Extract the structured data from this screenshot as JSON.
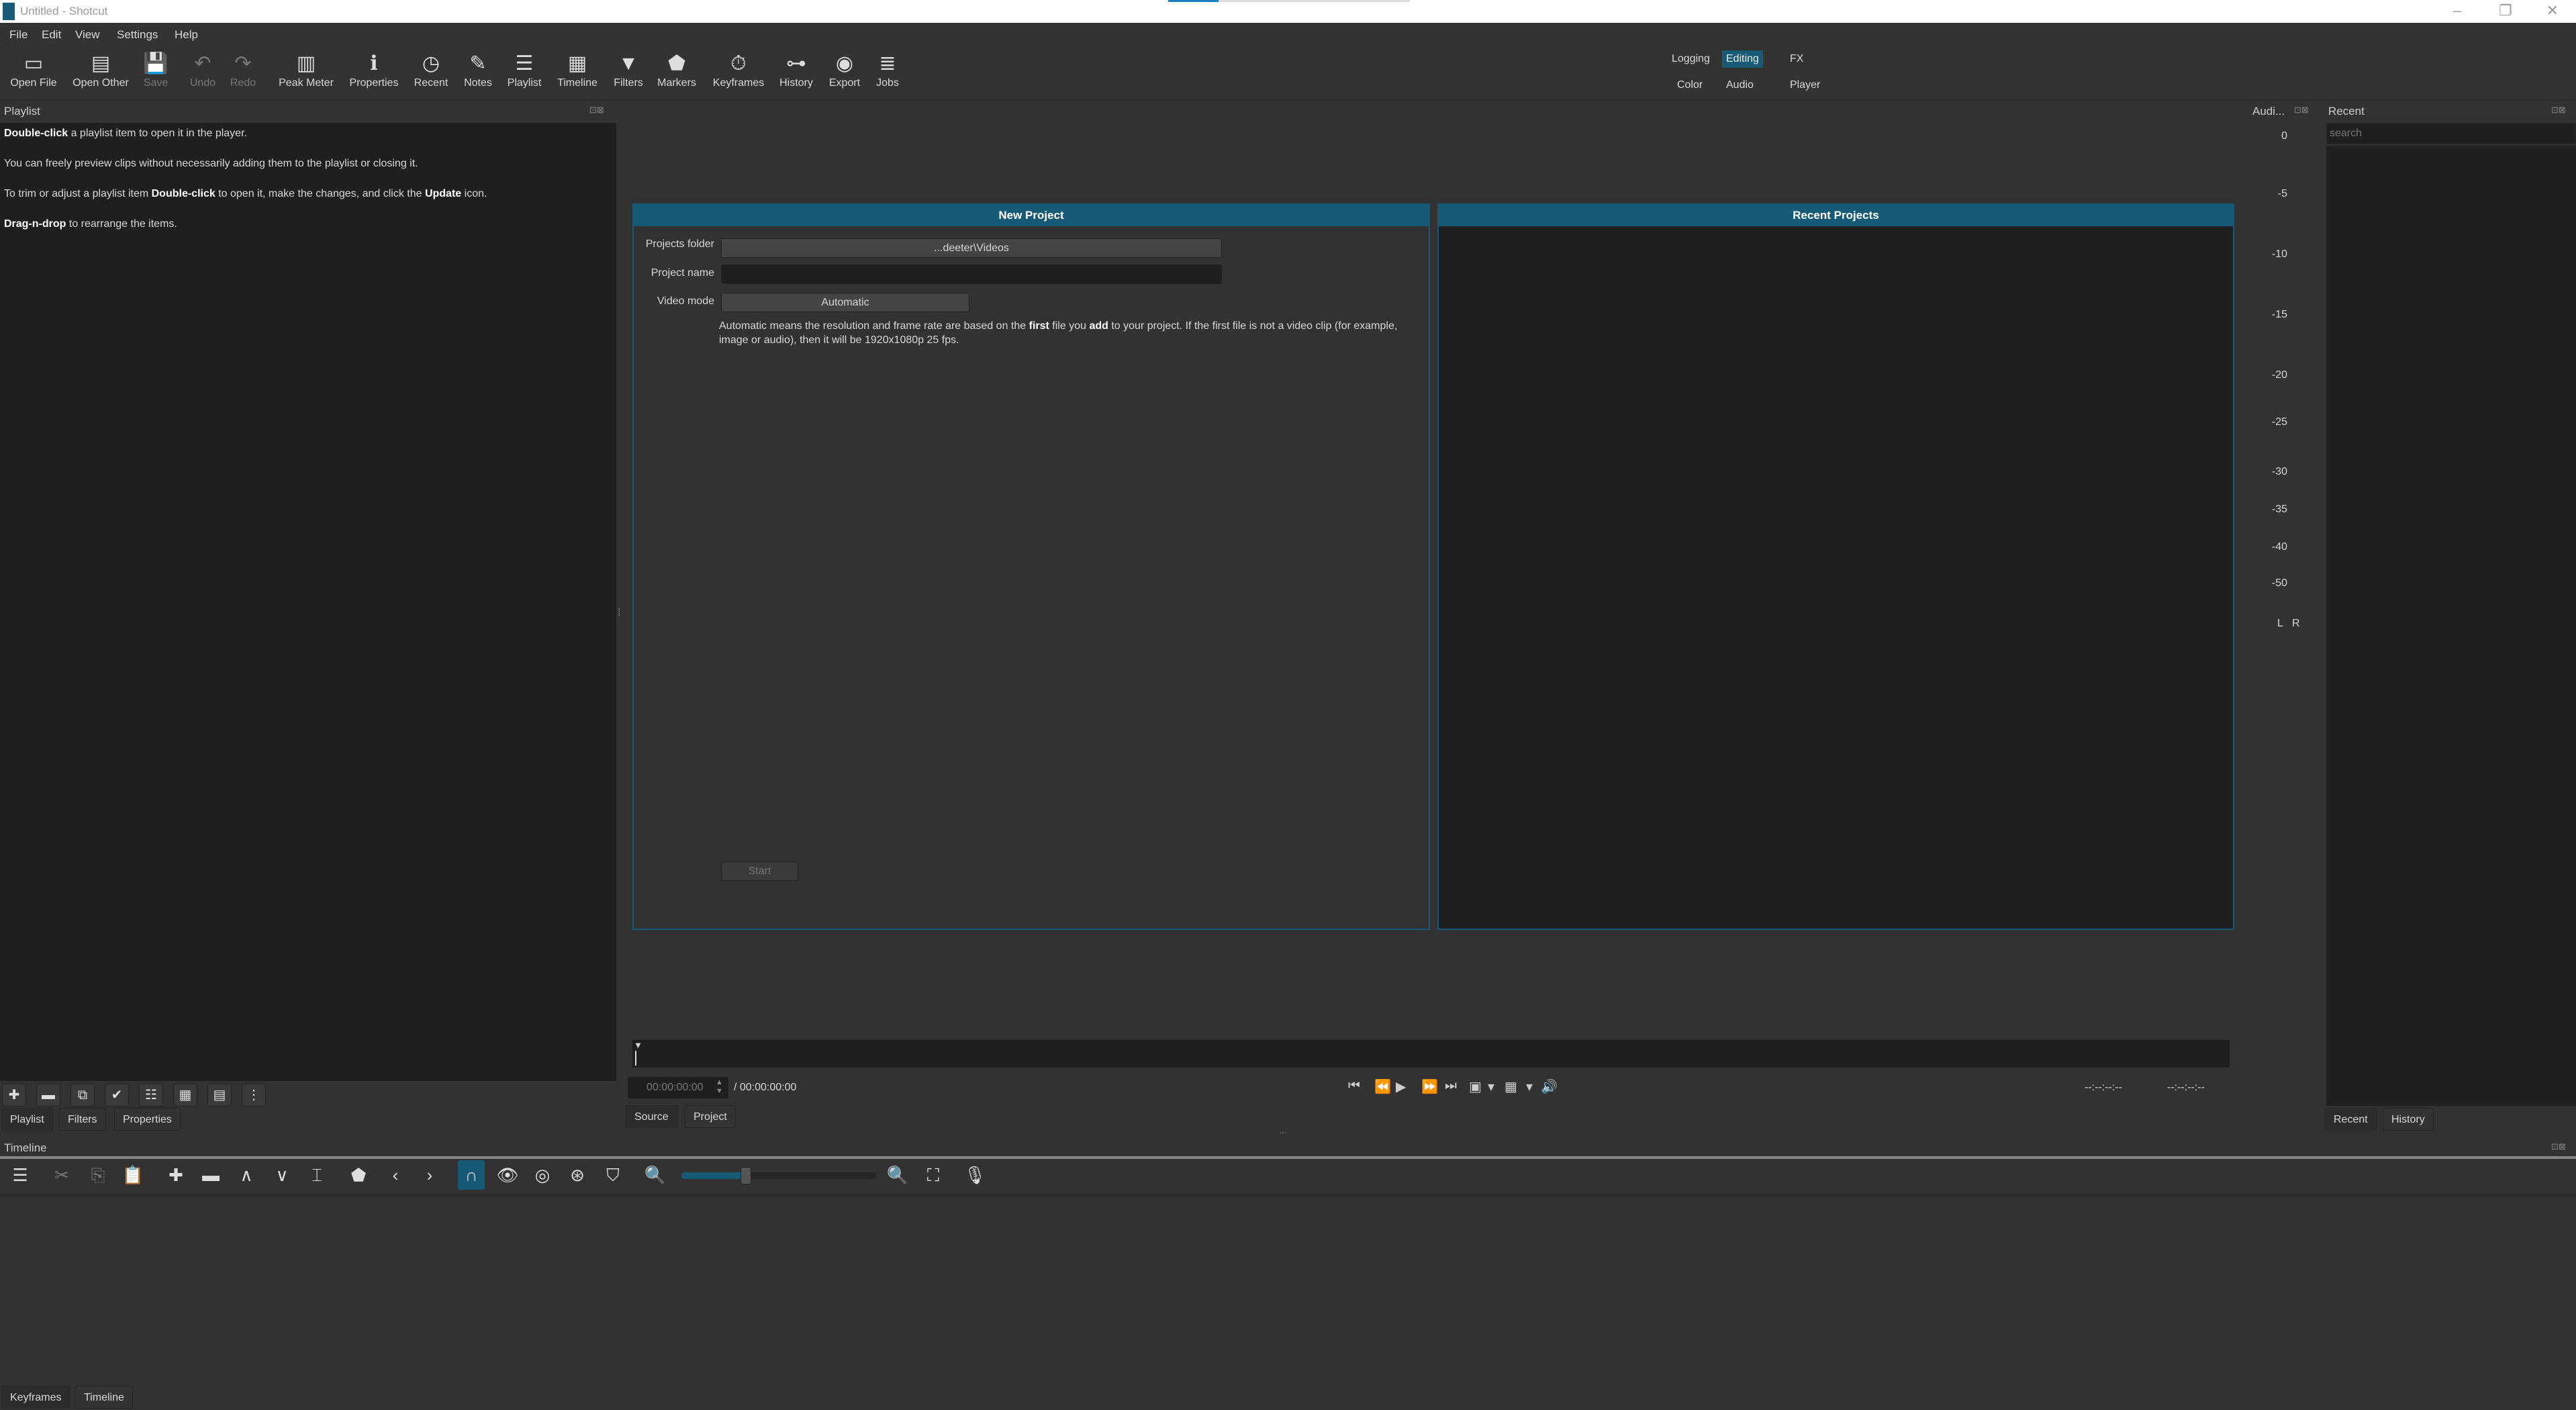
{
  "window": {
    "title": "Untitled - Shotcut",
    "minimize": "–",
    "restore": "❐",
    "close": "✕"
  },
  "menu": [
    "File",
    "Edit",
    "View",
    "Settings",
    "Help"
  ],
  "toolbar": [
    {
      "label": "Open File",
      "icon": "folder-icon",
      "glyph": "▭"
    },
    {
      "label": "Open Other",
      "icon": "open-other-icon",
      "glyph": "▤"
    },
    {
      "label": "Save",
      "icon": "save-icon",
      "glyph": "💾",
      "disabled": true
    },
    {
      "label": "Undo",
      "icon": "undo-icon",
      "glyph": "↶",
      "disabled": true
    },
    {
      "label": "Redo",
      "icon": "redo-icon",
      "glyph": "↷",
      "disabled": true
    },
    {
      "label": "Peak Meter",
      "icon": "peak-meter-icon",
      "glyph": "▥"
    },
    {
      "label": "Properties",
      "icon": "info-icon",
      "glyph": "ℹ"
    },
    {
      "label": "Recent",
      "icon": "clock-icon",
      "glyph": "◷"
    },
    {
      "label": "Notes",
      "icon": "notes-icon",
      "glyph": "✎"
    },
    {
      "label": "Playlist",
      "icon": "list-icon",
      "glyph": "☰"
    },
    {
      "label": "Timeline",
      "icon": "timeline-icon",
      "glyph": "▦"
    },
    {
      "label": "Filters",
      "icon": "filter-icon",
      "glyph": "▼"
    },
    {
      "label": "Markers",
      "icon": "marker-icon",
      "glyph": "⬟"
    },
    {
      "label": "Keyframes",
      "icon": "stopwatch-icon",
      "glyph": "⏱"
    },
    {
      "label": "History",
      "icon": "history-icon",
      "glyph": "⊶"
    },
    {
      "label": "Export",
      "icon": "disc-icon",
      "glyph": "◉"
    },
    {
      "label": "Jobs",
      "icon": "jobs-icon",
      "glyph": "≣"
    }
  ],
  "workspaces": {
    "row1": [
      "Logging",
      "Editing",
      "FX"
    ],
    "row2": [
      "Color",
      "Audio",
      "Player"
    ],
    "active": "Editing"
  },
  "playlist": {
    "title": "Playlist",
    "lines": [
      [
        {
          "b": "Double-click"
        },
        {
          "t": " a playlist item to open it in the player."
        }
      ],
      [
        {
          "t": "You can freely preview clips without necessarily adding them to the playlist or closing it."
        }
      ],
      [
        {
          "t": "To trim or adjust a playlist item "
        },
        {
          "b": "Double-click"
        },
        {
          "t": " to open it, make the changes, and click the "
        },
        {
          "b": "Update"
        },
        {
          "t": " icon."
        }
      ],
      [
        {
          "b": "Drag-n-drop"
        },
        {
          "t": " to rearrange the items."
        }
      ]
    ],
    "buttons": [
      {
        "n": "add",
        "g": "✚"
      },
      {
        "n": "remove",
        "g": "▬"
      },
      {
        "n": "update",
        "g": "⧉"
      },
      {
        "n": "check",
        "g": "✔"
      },
      {
        "n": "details-view",
        "g": "☷"
      },
      {
        "n": "tiles-view",
        "g": "▦"
      },
      {
        "n": "icons-view",
        "g": "▤"
      },
      {
        "n": "menu",
        "g": "⋮"
      }
    ]
  },
  "left_tabs": [
    "Playlist",
    "Filters",
    "Properties"
  ],
  "new_project": {
    "title": "New Project",
    "folder_label": "Projects folder",
    "folder_value": "...deeter\\Videos",
    "name_label": "Project name",
    "name_value": "",
    "mode_label": "Video mode",
    "mode_value": "Automatic",
    "desc": [
      {
        "t": "Automatic means the resolution and frame rate are based on the "
      },
      {
        "b": "first"
      },
      {
        "t": " file you "
      },
      {
        "b": "add"
      },
      {
        "t": " to your project. If the first file is not a video clip (for example, image or audio), then it will be 1920x1080p 25 fps."
      }
    ],
    "start": "Start"
  },
  "recent_projects": {
    "title": "Recent Projects"
  },
  "player": {
    "position": "00:00:00:00",
    "duration": "/ 00:00:00:00",
    "in_point": "--:--:--:--",
    "out_point": "--:--:--:--",
    "tabs": [
      "Source",
      "Project"
    ]
  },
  "audio_meter": {
    "title": "Audi...",
    "ticks": [
      "0",
      "-5",
      "-10",
      "-15",
      "-20",
      "-25",
      "-30",
      "-35",
      "-40",
      "-50"
    ],
    "channels": [
      "L",
      "R"
    ]
  },
  "recent": {
    "title": "Recent",
    "search_placeholder": "search",
    "tabs": [
      "Recent",
      "History"
    ]
  },
  "timeline": {
    "title": "Timeline",
    "zoom_percent": 33,
    "accent": "#175a75"
  },
  "bottom_tabs": [
    "Keyframes",
    "Timeline"
  ]
}
